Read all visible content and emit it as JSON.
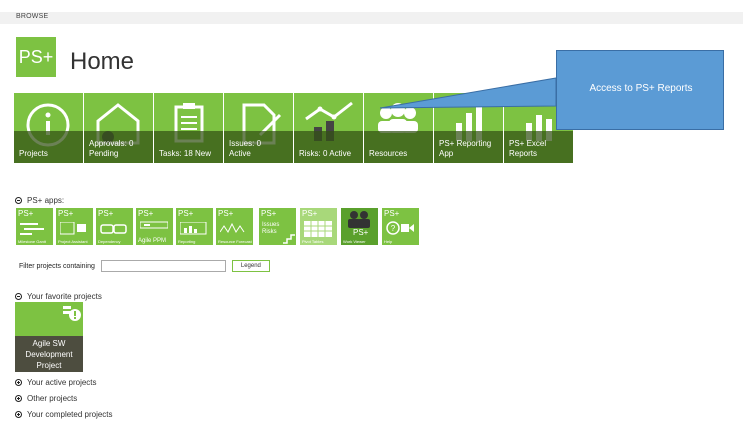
{
  "browse": "BROWSE",
  "logo": "PS+",
  "title": "Home",
  "tiles": [
    {
      "label": "Projects"
    },
    {
      "label": "Approvals: 0\nPending"
    },
    {
      "label": "Tasks: 18 New"
    },
    {
      "label": "Issues: 0\nActive"
    },
    {
      "label": "Risks: 0 Active"
    },
    {
      "label": "Resources"
    },
    {
      "label": "PS+ Reporting\nApp"
    },
    {
      "label": "PS+ Excel\nReports"
    }
  ],
  "callout": "Access to PS+ Reports",
  "apps_section": "PS+ apps:",
  "apps": [
    {
      "ps": "PS+",
      "name": "Milestone Gantt"
    },
    {
      "ps": "PS+",
      "name": "Project Assistant"
    },
    {
      "ps": "PS+",
      "name": "Dependency"
    },
    {
      "ps": "PS+",
      "name": "Agile PPM"
    },
    {
      "ps": "PS+",
      "name": "Reporting"
    },
    {
      "ps": "PS+",
      "name": "Resource Forecast"
    },
    {
      "ps": "PS+",
      "name": "Issues\nRisks"
    },
    {
      "ps": "PS+",
      "name": "Pivot Tables"
    },
    {
      "ps": "PS+",
      "name": "Work Viewer"
    },
    {
      "ps": "PS+",
      "name": "Help"
    }
  ],
  "filter_label": "Filter projects containing",
  "filter_value": "",
  "legend_button": "Legend",
  "favorites_section": "Your favorite projects",
  "favorite_project": "Agile SW\nDevelopment\nProject",
  "active_section": "Your active projects",
  "other_section": "Other projects",
  "completed_section": "Your completed projects",
  "colors": {
    "accent": "#7dc242",
    "callout": "#5b9bd5"
  }
}
